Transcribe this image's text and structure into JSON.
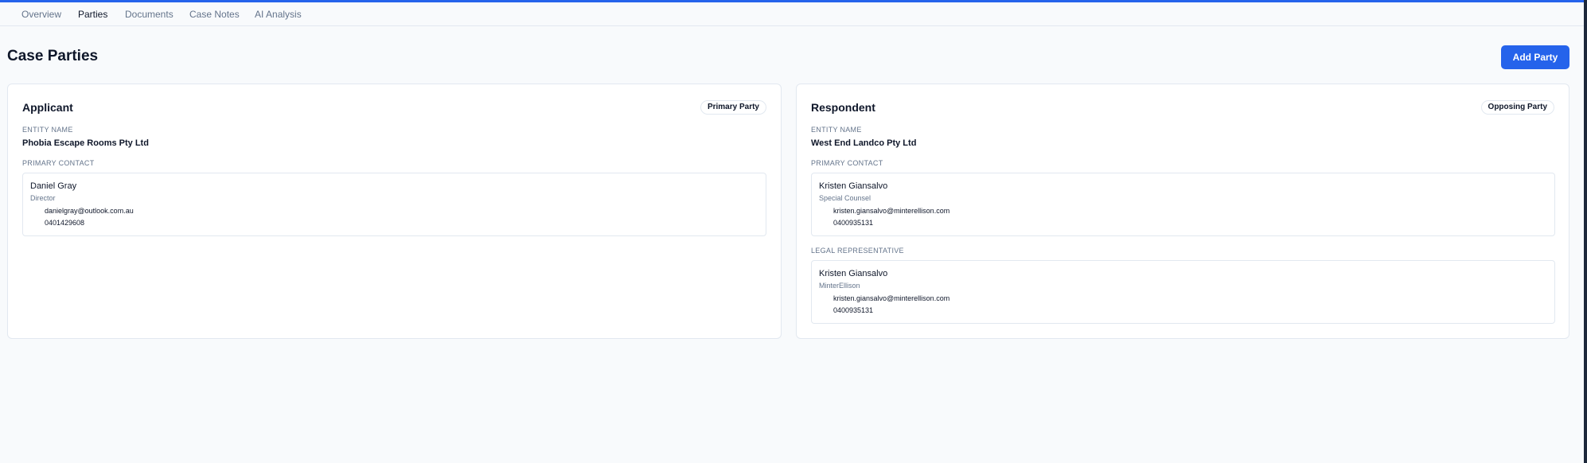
{
  "tabs": [
    {
      "label": "Overview"
    },
    {
      "label": "Parties"
    },
    {
      "label": "Documents"
    },
    {
      "label": "Case Notes"
    },
    {
      "label": "AI Analysis"
    }
  ],
  "active_tab": "Parties",
  "page_title": "Case Parties",
  "add_party_label": "Add Party",
  "accent_color": "#2563eb",
  "applicant": {
    "title": "Applicant",
    "badge": "Primary Party",
    "entity_label": "ENTITY NAME",
    "entity_name": "Phobia Escape Rooms Pty Ltd",
    "contact_label": "PRIMARY CONTACT",
    "contact": {
      "name": "Daniel Gray",
      "role": "Director",
      "email": "danielgray@outlook.com.au",
      "phone": "0401429608"
    }
  },
  "respondent": {
    "title": "Respondent",
    "badge": "Opposing Party",
    "entity_label": "ENTITY NAME",
    "entity_name": "West End Landco Pty Ltd",
    "contact_label": "PRIMARY CONTACT",
    "contact": {
      "name": "Kristen Giansalvo",
      "role": "Special Counsel",
      "email": "kristen.giansalvo@minterellison.com",
      "phone": "0400935131"
    },
    "legal_label": "LEGAL REPRESENTATIVE",
    "legal": {
      "name": "Kristen Giansalvo",
      "role": "MinterEllison",
      "email": "kristen.giansalvo@minterellison.com",
      "phone": "0400935131"
    }
  }
}
